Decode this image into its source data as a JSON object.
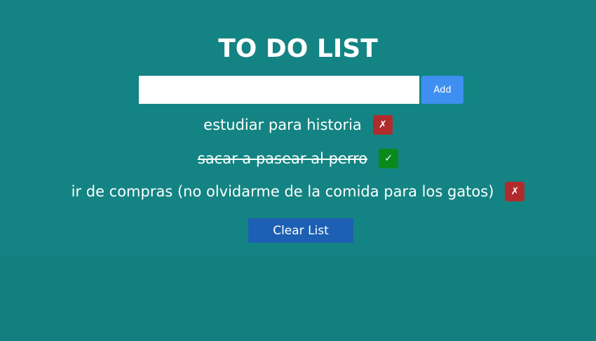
{
  "header": {
    "title": "TO DO LIST"
  },
  "form": {
    "input_value": "",
    "input_placeholder": "",
    "add_label": "Add"
  },
  "todos": [
    {
      "text": "estudiar para historia",
      "done": false,
      "status_icon": "✗"
    },
    {
      "text": "sacar a pasear al perro",
      "done": true,
      "status_icon": "✓"
    },
    {
      "text": "ir de compras (no olvidarme de la comida para los gatos)",
      "done": false,
      "status_icon": "✗"
    }
  ],
  "footer": {
    "clear_label": "Clear List"
  },
  "colors": {
    "background": "#138483",
    "add_button": "#3f8ff2",
    "pending": "#b02c2c",
    "complete": "#0a8a1d",
    "clear_button": "#1d60b3"
  }
}
